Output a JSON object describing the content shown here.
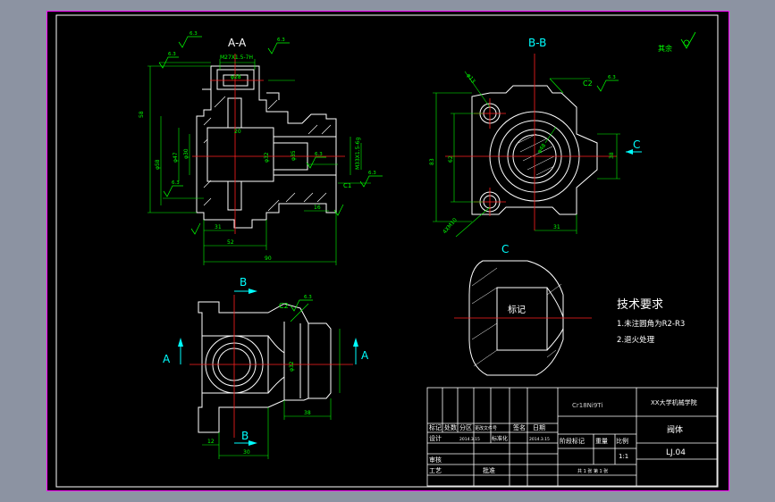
{
  "drawing": {
    "section_aa_title": "A-A",
    "section_bb_title": "B-B",
    "view_c_title": "C",
    "arrow_c_label": "C",
    "arrow_a_left": "A",
    "arrow_a_right": "A",
    "arrow_b_top": "B",
    "arrow_b_bottom": "B",
    "roughness_note": "其余",
    "marking_label": "标记",
    "chamfer_c2_aa": "C2",
    "chamfer_c2_bb": "C2",
    "chamfer_c2_bottom": "C2",
    "chamfer_c1": "C1",
    "dims_aa": {
      "d_top_thread": "M27X1.5-7H",
      "d_width": "20",
      "d_left_height": "58",
      "d_bottom_90": "90",
      "d_bottom_52": "52",
      "d_bottom_31": "31",
      "d_right_16": "16",
      "d_right_thread": "M33X1.5-6g",
      "d_phi28": "φ28",
      "d_phi58": "φ58",
      "d_phi47": "φ47",
      "d_phi30": "φ30",
      "d_phi32": "φ32",
      "d_phi35": "φ35"
    },
    "dims_bb": {
      "d_height_left": "83",
      "d_height_inner": "62",
      "d_bottom": "31",
      "d_right": "38",
      "d_hole": "4XM10",
      "d_phi13": "φ13",
      "d_phi48": "φ48"
    },
    "dims_front": {
      "d_bottom_30": "30",
      "d_bottom_38": "38",
      "d_left_12": "12",
      "d_phi32": "φ32"
    },
    "roughness_value": "6.3"
  },
  "tech_requirements": {
    "title": "技术要求",
    "items": [
      "1.未注圆角为R2-R3",
      "2.退火处理"
    ]
  },
  "title_block": {
    "material": "Cr18Ni9Ti",
    "institute": "XX大学机械学院",
    "part_name": "阀体",
    "drawing_no": "LJ.04",
    "scale": "1:1",
    "headers": [
      "标记",
      "处数",
      "分区",
      "更改文件号",
      "签名",
      "日期"
    ],
    "row_design": [
      "设计",
      "",
      "2014.3.15",
      "标准化",
      "",
      "2014.3.15"
    ],
    "stage_label": "阶段标记",
    "weight_label": "重量",
    "scale_label": "比例",
    "review_label": "审核",
    "process_label": "工艺",
    "approve_label": "批准",
    "sheet_info": "共 1 张 第 1 张"
  },
  "colors": {
    "background": "#8c93a2",
    "sheet": "#000000",
    "border": "#ff00ff",
    "outline": "#ffffff",
    "dimension": "#00ff00",
    "centerline": "#ff2020",
    "label": "#00ffff"
  }
}
